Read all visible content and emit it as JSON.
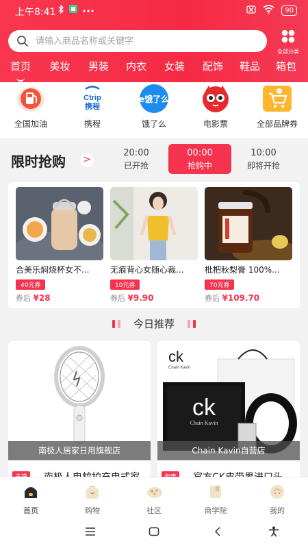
{
  "status_bar": {
    "time": "上午8:41",
    "battery": "90"
  },
  "search": {
    "placeholder": "请输入商品名称或关键字"
  },
  "all_categories_label": "全部分类",
  "categories": [
    "首页",
    "美妆",
    "男装",
    "内衣",
    "女装",
    "配饰",
    "鞋品",
    "箱包"
  ],
  "services": [
    {
      "label": "全国加油",
      "icon": "gas-station-icon"
    },
    {
      "label": "携程",
      "icon": "ctrip-logo-icon",
      "logo_text": "Ctrip 携程"
    },
    {
      "label": "饿了么",
      "icon": "eleme-logo-icon",
      "logo_text": "饿了么"
    },
    {
      "label": "电影票",
      "icon": "cat-eye-movie-icon"
    },
    {
      "label": "全部品牌券",
      "icon": "shopping-cart-icon"
    }
  ],
  "flash_sale": {
    "title": "限时抢购",
    "arrow": ">",
    "slots": [
      {
        "time": "20:00",
        "status": "已开抢"
      },
      {
        "time": "00:00",
        "status": "抢购中"
      },
      {
        "time": "10:00",
        "status": "即将开抢"
      }
    ]
  },
  "products": [
    {
      "name": "合美乐焖烧杯女不...",
      "coupon": "40元券",
      "price_prefix": "券后",
      "price": "¥28"
    },
    {
      "name": "无痕背心女随心裁...",
      "coupon": "10元券",
      "price_prefix": "券后",
      "price": "¥9.90"
    },
    {
      "name": "枇杷秋梨膏 100%...",
      "coupon": "70元券",
      "price_prefix": "券后",
      "price": "¥109.70"
    }
  ],
  "recommend": {
    "title": "今日推荐"
  },
  "cards": [
    {
      "shop": "南极人居家日用旗舰店",
      "tag": "天猫",
      "title": "南极人电蚊拍充电式家"
    },
    {
      "shop": "Chain Kavin自营店",
      "tag": "淘宝",
      "title": "官方CK皮带男进口头",
      "brand_mark": "ck",
      "brand_name": "Chain Kavin"
    }
  ],
  "tabs": [
    {
      "label": "首页",
      "icon": "home-icon"
    },
    {
      "label": "购物",
      "icon": "shopping-bag-icon"
    },
    {
      "label": "社区",
      "icon": "community-icon"
    },
    {
      "label": "商学院",
      "icon": "book-icon"
    },
    {
      "label": "我的",
      "icon": "profile-icon"
    }
  ],
  "colors": {
    "brand_red": "#f5334e",
    "header_red": "#f62a44"
  }
}
